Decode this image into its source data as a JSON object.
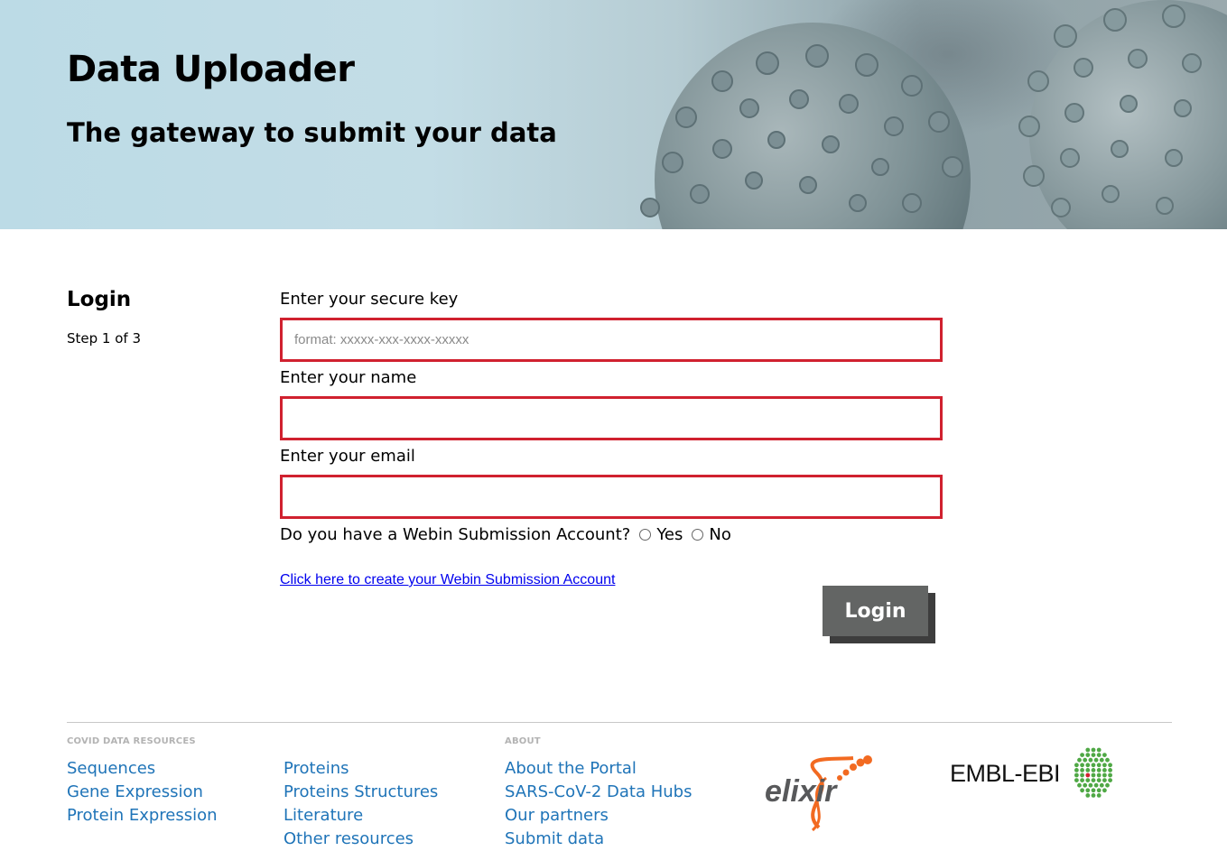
{
  "hero": {
    "title": "Data Uploader",
    "subtitle": "The gateway to submit your data"
  },
  "login": {
    "title": "Login",
    "step": "Step 1 of 3",
    "key_label": "Enter your secure key",
    "key_placeholder": "format: xxxxx-xxx-xxxx-xxxxx",
    "key_value": "",
    "name_label": "Enter your name",
    "name_value": "",
    "email_label": "Enter your email",
    "email_value": "",
    "webin_question": "Do you have a Webin Submission Account?",
    "webin_options": [
      "Yes",
      "No"
    ],
    "create_link": "Click here to create your Webin Submission Account",
    "login_button": "Login",
    "error_color": "#d0212f"
  },
  "footer": {
    "covid_heading": "COVID DATA RESOURCES",
    "covid_col1": [
      "Sequences",
      "Gene Expression",
      "Protein Expression"
    ],
    "covid_col2": [
      "Proteins",
      "Proteins Structures",
      "Literature",
      "Other resources"
    ],
    "about_heading": "ABOUT",
    "about_links": [
      "About the Portal",
      "SARS-CoV-2 Data Hubs",
      "Our partners",
      "Submit data"
    ],
    "elixir_logo_text": "elixir",
    "embl_logo_text": "EMBL-EBI",
    "link_color": "#1f74b8"
  }
}
